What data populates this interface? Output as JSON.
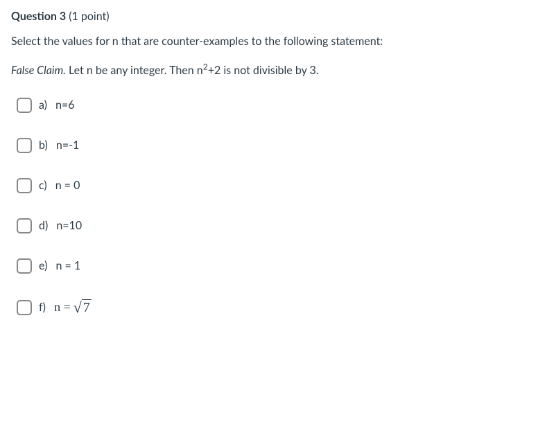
{
  "header": {
    "question_label": "Question 3",
    "points": "(1 point)"
  },
  "prompt": "Select the values for n that are counter-examples to the following statement:",
  "claim": {
    "label": "False Claim.",
    "pre": " Let n be any integer. Then n",
    "exp": "2",
    "post": "+2 is not divisible by 3."
  },
  "options": {
    "a": {
      "letter": "a)",
      "text": "n=6"
    },
    "b": {
      "letter": "b)",
      "text": "n=-1"
    },
    "c": {
      "letter": "c)",
      "text": "n = 0"
    },
    "d": {
      "letter": "d)",
      "text": "n=10"
    },
    "e": {
      "letter": "e)",
      "text": "n = 1"
    },
    "f": {
      "letter": "f)",
      "eq_lhs": "n = ",
      "sqrt_arg": "7"
    }
  }
}
